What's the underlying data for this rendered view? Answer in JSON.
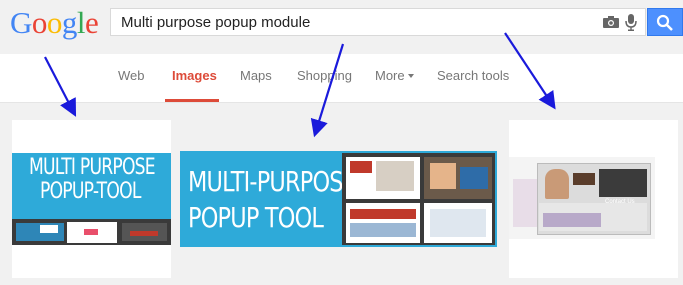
{
  "logo": {
    "letters": [
      "G",
      "o",
      "o",
      "g",
      "l",
      "e"
    ],
    "colors": [
      "#4285f4",
      "#ea4335",
      "#fbbc05",
      "#4285f4",
      "#34a853",
      "#ea4335"
    ]
  },
  "search": {
    "query": "Multi purpose popup module"
  },
  "icons": {
    "camera": "camera-icon",
    "mic": "microphone-icon",
    "search": "search-icon"
  },
  "tabs": [
    {
      "label": "Web"
    },
    {
      "label": "Images",
      "active": true
    },
    {
      "label": "Maps"
    },
    {
      "label": "Shopping"
    },
    {
      "label": "More"
    },
    {
      "label": "Search tools"
    }
  ],
  "results": [
    {
      "thumb_lines": [
        "MULTI PURPOSE",
        "POPUP-TOOL"
      ]
    },
    {
      "thumb_lines": [
        "MULTI-PURPOSE",
        "POPUP TOOL"
      ]
    },
    {
      "thumb_caption": "Contact Us"
    }
  ],
  "colors": {
    "accent": "#dd4b39",
    "button": "#4d90fe",
    "thumb_blue": "#2eaad9",
    "arrow": "#1a1adb"
  }
}
